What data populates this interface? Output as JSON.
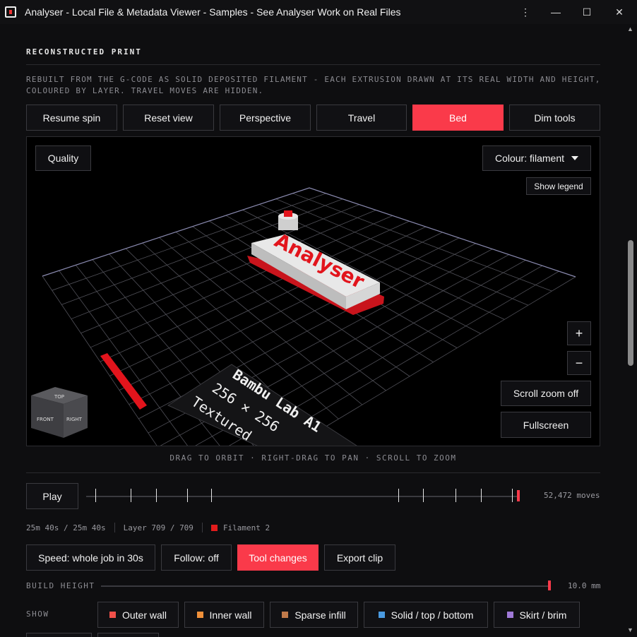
{
  "window": {
    "title": "Analyser - Local File & Metadata Viewer - Samples - See Analyser Work on Real Files",
    "controls": [
      "⋮",
      "—",
      "☐",
      "✕"
    ]
  },
  "section": {
    "title": "RECONSTRUCTED PRINT",
    "description": "REBUILT FROM THE G-CODE AS SOLID DEPOSITED FILAMENT - EACH EXTRUSION DRAWN AT ITS REAL WIDTH AND HEIGHT, COLOURED BY LAYER. TRAVEL MOVES ARE HIDDEN."
  },
  "toolbar": {
    "buttons": [
      {
        "label": "Resume spin",
        "active": false
      },
      {
        "label": "Reset view",
        "active": false
      },
      {
        "label": "Perspective",
        "active": false
      },
      {
        "label": "Travel",
        "active": false
      },
      {
        "label": "Bed",
        "active": true
      },
      {
        "label": "Dim tools",
        "active": false
      }
    ]
  },
  "viewport": {
    "quality_label": "Quality",
    "colour_label": "Colour: filament",
    "legend_label": "Show legend",
    "zoom_in": "+",
    "zoom_out": "−",
    "scroll_zoom_label": "Scroll zoom off",
    "fullscreen_label": "Fullscreen",
    "model_text": "Analyser",
    "bed_lines": [
      "Bambu Lab A1",
      "256 × 256",
      "Textured"
    ],
    "cube_faces": {
      "top": "TOP",
      "front": "FRONT",
      "right": "RIGHT"
    }
  },
  "hint": "DRAG TO ORBIT · RIGHT-DRAG TO PAN · SCROLL TO ZOOM",
  "playback": {
    "play_label": "Play",
    "moves": "52,472 moves",
    "progress": 1.0
  },
  "status": {
    "time": "25m 40s / 25m 40s",
    "layer": "Layer 709 / 709",
    "filament": "Filament 2",
    "filament_color": "#e21c1c"
  },
  "actions": [
    {
      "label": "Speed: whole job in 30s",
      "active": false
    },
    {
      "label": "Follow: off",
      "active": false
    },
    {
      "label": "Tool changes",
      "active": true
    },
    {
      "label": "Export clip",
      "active": false
    }
  ],
  "build_height": {
    "label": "BUILD HEIGHT",
    "value": "10.0 mm",
    "fraction": 1.0
  },
  "show": {
    "label": "SHOW",
    "chips": [
      {
        "label": "Outer wall",
        "color": "#f0504a"
      },
      {
        "label": "Inner wall",
        "color": "#f0903a"
      },
      {
        "label": "Sparse infill",
        "color": "#c07a4a"
      },
      {
        "label": "Solid / top / bottom",
        "color": "#4a9ae0"
      },
      {
        "label": "Skirt / brim",
        "color": "#a07ad8"
      }
    ]
  },
  "colors": {
    "accent": "#fa3a4a",
    "background": "#0e0e10"
  }
}
